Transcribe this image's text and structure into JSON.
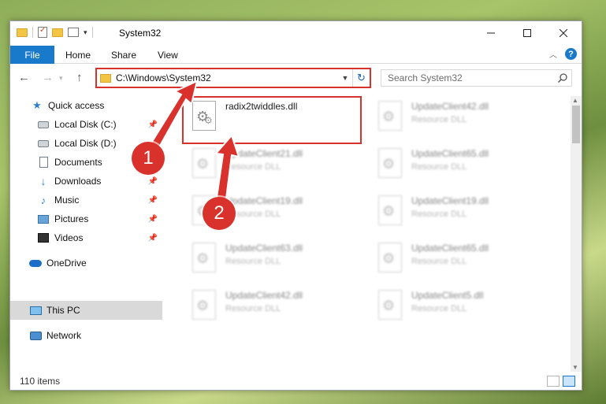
{
  "window": {
    "title": "System32",
    "controls": {
      "minimize": "–",
      "maximize": "☐",
      "close": "✕"
    }
  },
  "ribbon": {
    "tabs": [
      "File",
      "Home",
      "Share",
      "View"
    ],
    "help": "?"
  },
  "navbar": {
    "back": "←",
    "forward": "→",
    "up": "↑",
    "address": "C:\\Windows\\System32",
    "search_placeholder": "Search System32"
  },
  "sidebar": {
    "items": [
      {
        "label": "Quick access",
        "icon": "star-icon",
        "pinned": false
      },
      {
        "label": "Local Disk (C:)",
        "icon": "disk-icon",
        "pinned": true
      },
      {
        "label": "Local Disk (D:)",
        "icon": "disk-icon",
        "pinned": false
      },
      {
        "label": "Documents",
        "icon": "documents-icon",
        "pinned": false
      },
      {
        "label": "Downloads",
        "icon": "download-icon",
        "pinned": true
      },
      {
        "label": "Music",
        "icon": "music-icon",
        "pinned": true
      },
      {
        "label": "Pictures",
        "icon": "pictures-icon",
        "pinned": true
      },
      {
        "label": "Videos",
        "icon": "videos-icon",
        "pinned": true
      },
      {
        "label": "OneDrive",
        "icon": "onedrive-icon",
        "pinned": false
      },
      {
        "label": "This PC",
        "icon": "this-pc-icon",
        "pinned": false,
        "selected": true
      },
      {
        "label": "Network",
        "icon": "network-icon",
        "pinned": false
      }
    ]
  },
  "files": [
    {
      "name": "radix2twiddles.dll",
      "type": ""
    },
    {
      "name": "UpdateClient42.dll",
      "type": "Resource DLL"
    },
    {
      "name": "UpdateClient21.dll",
      "type": "Resource DLL"
    },
    {
      "name": "UpdateClient65.dll",
      "type": "Resource DLL"
    },
    {
      "name": "UpdateClient19.dll",
      "type": "Resource DLL"
    },
    {
      "name": "UpdateClient19.dll",
      "type": "Resource DLL"
    },
    {
      "name": "UpdateClient63.dll",
      "type": "Resource DLL"
    },
    {
      "name": "UpdateClient65.dll",
      "type": "Resource DLL"
    },
    {
      "name": "UpdateClient42.dll",
      "type": "Resource DLL"
    },
    {
      "name": "UpdateClient5.dll",
      "type": "Resource DLL"
    }
  ],
  "status": {
    "item_count": "110 items"
  },
  "callouts": [
    "1",
    "2"
  ],
  "colors": {
    "accent": "#1979ca",
    "highlight": "#d9312b"
  }
}
